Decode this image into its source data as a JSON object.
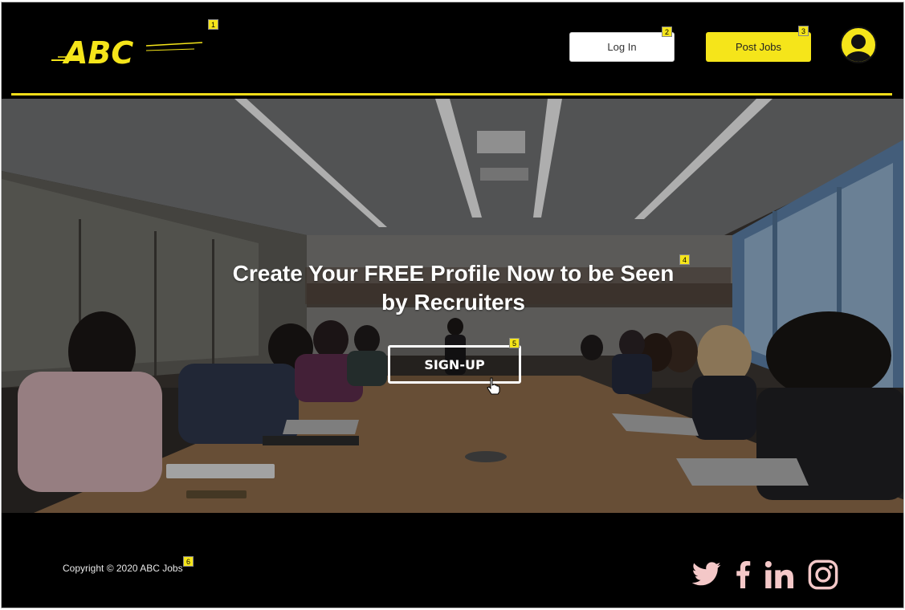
{
  "header": {
    "logo_text": "ABC",
    "login_label": "Log In",
    "post_jobs_label": "Post Jobs"
  },
  "hero": {
    "title_line1": "Create Your FREE Profile Now to be Seen",
    "title_line2": "by Recruiters",
    "signup_label": "SIGN-UP"
  },
  "footer": {
    "copyright": "Copyright © 2020 ABC Jobs",
    "social": [
      "twitter-icon",
      "facebook-icon",
      "linkedin-icon",
      "instagram-icon"
    ]
  },
  "markers": [
    "1",
    "2",
    "3",
    "4",
    "5",
    "6"
  ],
  "colors": {
    "accent": "#f5e51a",
    "background": "#000000",
    "social_icon": "#f4c8c8"
  }
}
